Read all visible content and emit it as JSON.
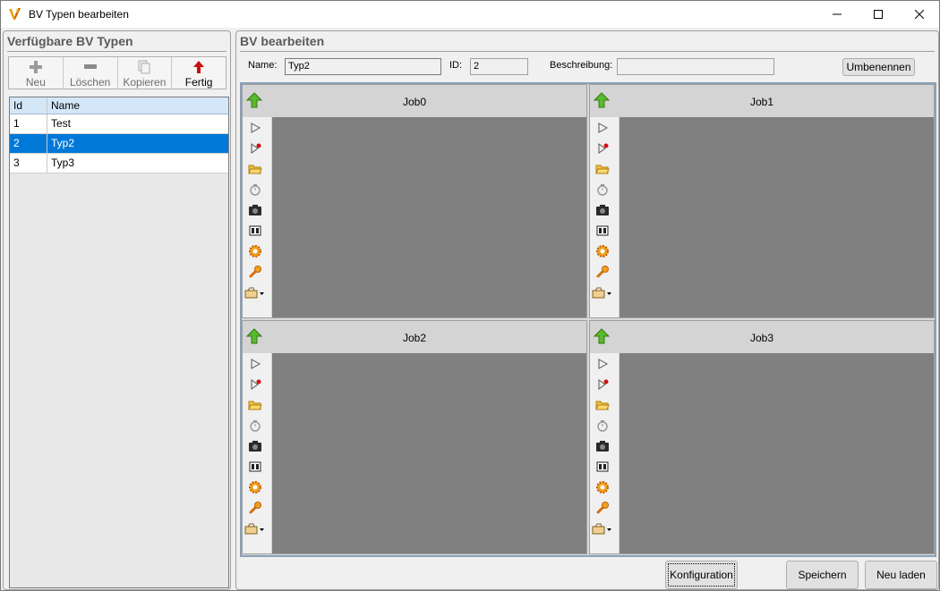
{
  "window": {
    "title": "BV Typen bearbeiten",
    "icon": "app-v-logo-icon"
  },
  "left": {
    "header": "Verfügbare BV Typen",
    "toolbar": [
      {
        "label": "Neu",
        "icon": "plus-icon",
        "enabled": false
      },
      {
        "label": "Löschen",
        "icon": "minus-icon",
        "enabled": false
      },
      {
        "label": "Kopieren",
        "icon": "copy-icon",
        "enabled": false
      },
      {
        "label": "Fertig",
        "icon": "arrow-up-red-icon",
        "enabled": true
      }
    ],
    "columns": [
      "Id",
      "Name"
    ],
    "rows": [
      {
        "id": "1",
        "name": "Test"
      },
      {
        "id": "2",
        "name": "Typ2"
      },
      {
        "id": "3",
        "name": "Typ3"
      }
    ],
    "selected_row": 1
  },
  "right": {
    "header": "BV bearbeiten",
    "name_label": "Name:",
    "name_value": "Typ2",
    "id_label": "ID:",
    "id_value": "2",
    "desc_label": "Beschreibung:",
    "desc_value": "",
    "rename_button": "Umbenennen",
    "jobs": [
      {
        "title": "Job0"
      },
      {
        "title": "Job1"
      },
      {
        "title": "Job2"
      },
      {
        "title": "Job3"
      }
    ],
    "config_button": "Konfiguration",
    "save_button": "Speichern",
    "reload_button": "Neu laden"
  }
}
